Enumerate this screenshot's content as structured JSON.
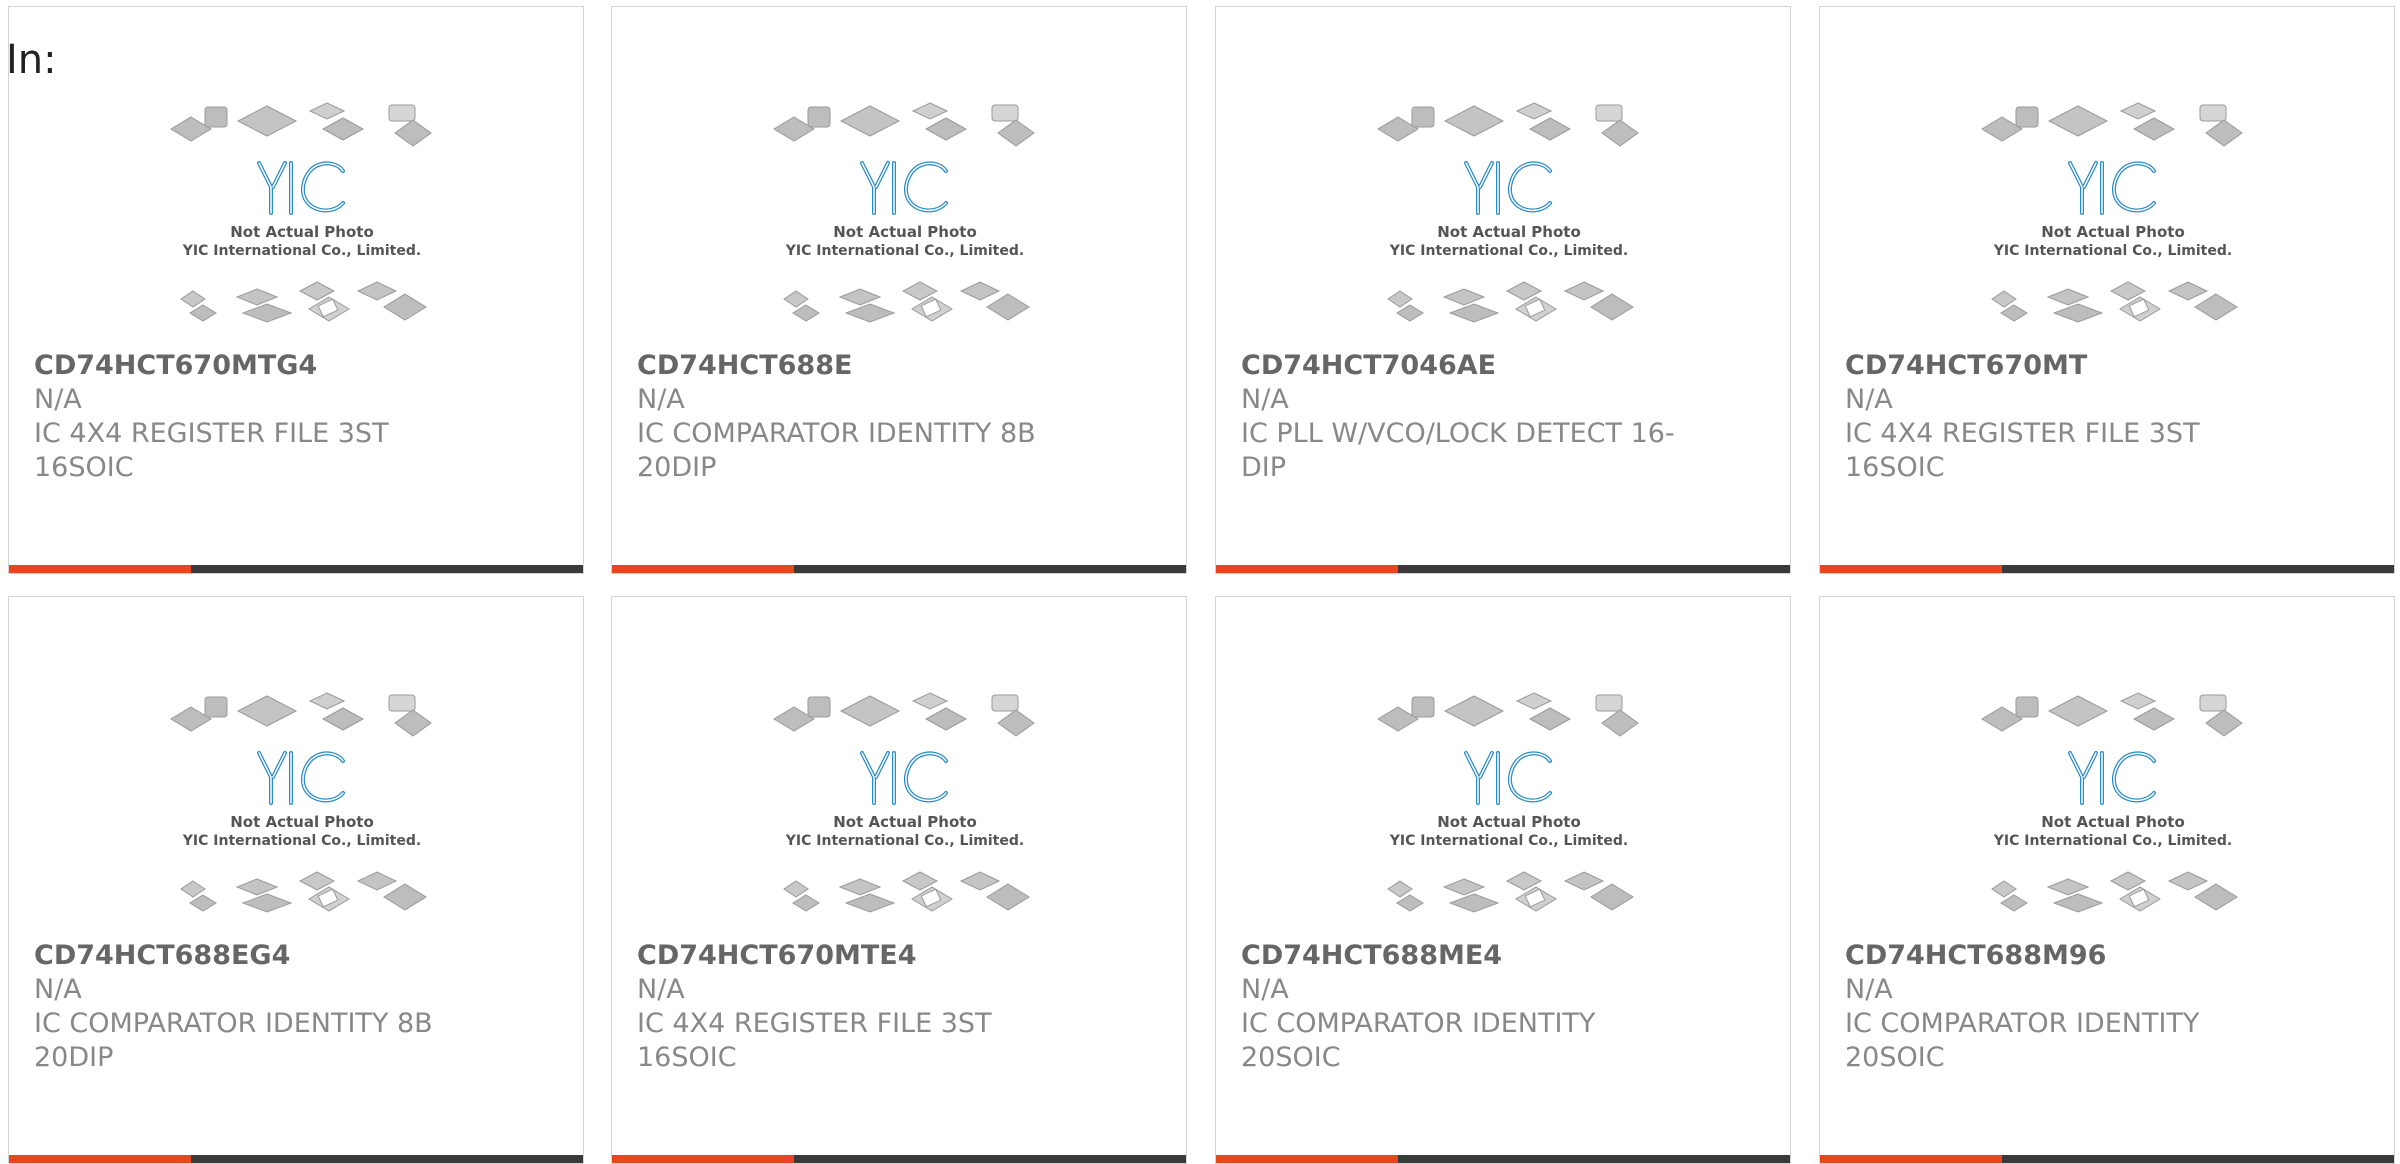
{
  "filter": {
    "label": "In:"
  },
  "placeholder_image": {
    "caption_line1": "Not Actual Photo",
    "caption_line2": "YIC International Co., Limited.",
    "logo_text": "YIC",
    "logo_color": "#2a8bc9"
  },
  "accent_color": "#e8461e",
  "products": [
    {
      "part_number": "CD74HCT670MTG4",
      "manufacturer": "N/A",
      "description": "IC 4X4 REGISTER FILE 3ST 16SOIC",
      "desc_line1": "IC 4X4 REGISTER FILE 3ST",
      "desc_line2": "16SOIC"
    },
    {
      "part_number": "CD74HCT688E",
      "manufacturer": "N/A",
      "description": "IC COMPARATOR IDENTITY 8B 20DIP",
      "desc_line1": "IC COMPARATOR IDENTITY 8B",
      "desc_line2": "20DIP"
    },
    {
      "part_number": "CD74HCT7046AE",
      "manufacturer": "N/A",
      "description": "IC PLL W/VCO/LOCK DETECT 16-DIP",
      "desc_line1": "IC PLL W/VCO/LOCK DETECT 16-",
      "desc_line2": "DIP"
    },
    {
      "part_number": "CD74HCT670MT",
      "manufacturer": "N/A",
      "description": "IC 4X4 REGISTER FILE 3ST 16SOIC",
      "desc_line1": "IC 4X4 REGISTER FILE 3ST",
      "desc_line2": "16SOIC"
    },
    {
      "part_number": "CD74HCT688EG4",
      "manufacturer": "N/A",
      "description": "IC COMPARATOR IDENTITY 8B 20DIP",
      "desc_line1": "IC COMPARATOR IDENTITY 8B",
      "desc_line2": "20DIP"
    },
    {
      "part_number": "CD74HCT670MTE4",
      "manufacturer": "N/A",
      "description": "IC 4X4 REGISTER FILE 3ST 16SOIC",
      "desc_line1": "IC 4X4 REGISTER FILE 3ST",
      "desc_line2": "16SOIC"
    },
    {
      "part_number": "CD74HCT688ME4",
      "manufacturer": "N/A",
      "description": "IC COMPARATOR IDENTITY 20SOIC",
      "desc_line1": "IC COMPARATOR IDENTITY",
      "desc_line2": "20SOIC"
    },
    {
      "part_number": "CD74HCT688M96",
      "manufacturer": "N/A",
      "description": "IC COMPARATOR IDENTITY 20SOIC",
      "desc_line1": "IC COMPARATOR IDENTITY",
      "desc_line2": "20SOIC"
    }
  ]
}
